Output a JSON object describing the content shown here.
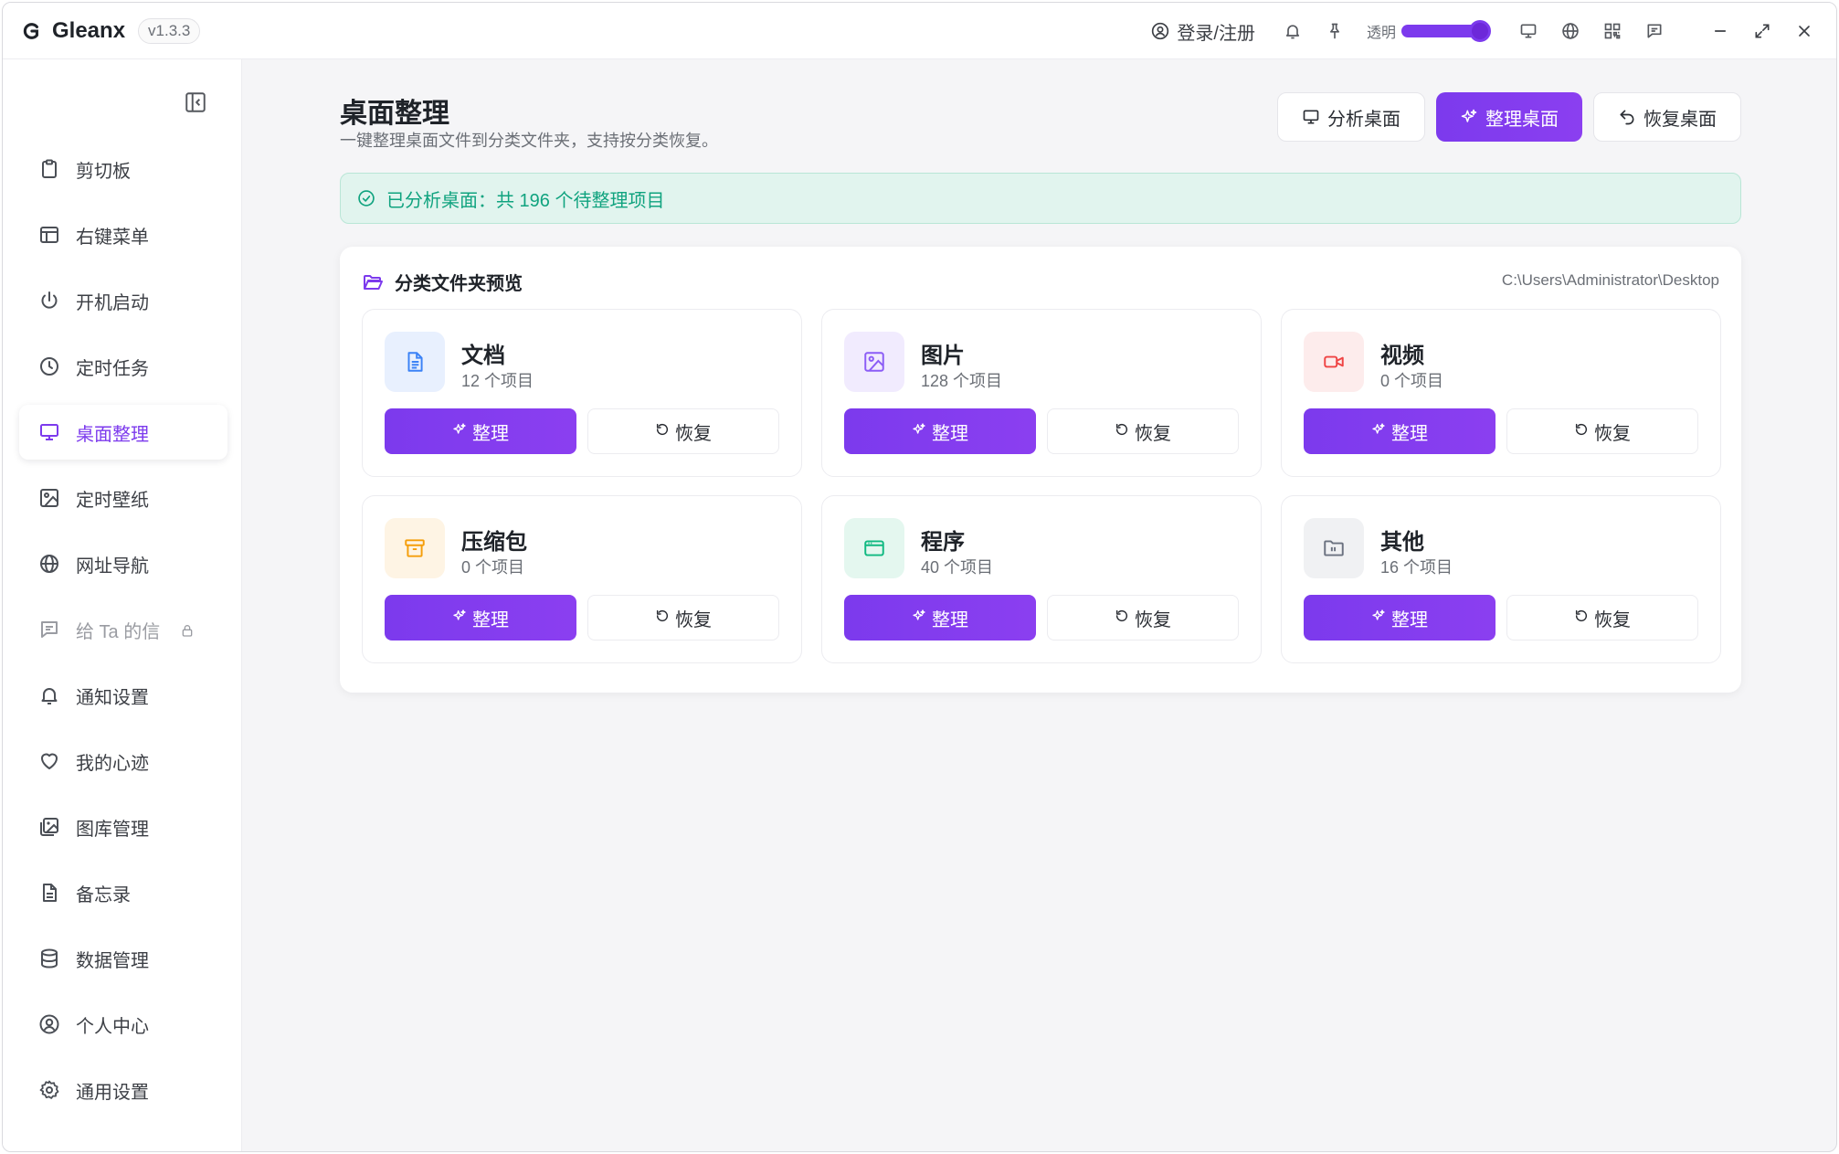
{
  "app": {
    "name": "Gleanx",
    "version": "v1.3.3"
  },
  "titlebar": {
    "login_label": "登录/注册",
    "opacity_label": "透明",
    "opacity_value": 0.9
  },
  "sidebar": {
    "items": [
      {
        "label": "剪切板",
        "icon": "clipboard-icon"
      },
      {
        "label": "右键菜单",
        "icon": "layout-icon"
      },
      {
        "label": "开机启动",
        "icon": "power-icon"
      },
      {
        "label": "定时任务",
        "icon": "clock-icon"
      },
      {
        "label": "桌面整理",
        "icon": "monitor-icon",
        "active": true
      },
      {
        "label": "定时壁纸",
        "icon": "image-icon"
      },
      {
        "label": "网址导航",
        "icon": "globe-icon"
      },
      {
        "label": "给 Ta 的信",
        "icon": "message-icon",
        "locked": true
      },
      {
        "label": "通知设置",
        "icon": "bell-icon"
      },
      {
        "label": "我的心迹",
        "icon": "heart-icon"
      },
      {
        "label": "图库管理",
        "icon": "images-icon"
      },
      {
        "label": "备忘录",
        "icon": "file-text-icon"
      },
      {
        "label": "数据管理",
        "icon": "database-icon"
      },
      {
        "label": "个人中心",
        "icon": "user-circle-icon"
      },
      {
        "label": "通用设置",
        "icon": "gear-icon"
      }
    ]
  },
  "page": {
    "title": "桌面整理",
    "subtitle": "一键整理桌面文件到分类文件夹，支持按分类恢复。",
    "actions": {
      "analyze": "分析桌面",
      "organize": "整理桌面",
      "restore": "恢复桌面"
    },
    "alert": "已分析桌面：共 196 个待整理项目"
  },
  "preview": {
    "title": "分类文件夹预览",
    "path": "C:\\Users\\Administrator\\Desktop",
    "organize_label": "整理",
    "restore_label": "恢复",
    "categories": [
      {
        "name": "文档",
        "count": "12 个项目",
        "color": "#3b82f6",
        "bg": "#e8f0fe",
        "icon": "document-icon"
      },
      {
        "name": "图片",
        "count": "128 个项目",
        "color": "#8b5cf6",
        "bg": "#f1ebfe",
        "icon": "image-icon"
      },
      {
        "name": "视频",
        "count": "0 个项目",
        "color": "#ef4444",
        "bg": "#fdecec",
        "icon": "video-icon"
      },
      {
        "name": "压缩包",
        "count": "0 个项目",
        "color": "#f59e0b",
        "bg": "#fef4e4",
        "icon": "archive-icon"
      },
      {
        "name": "程序",
        "count": "40 个项目",
        "color": "#10b981",
        "bg": "#e4f7ef",
        "icon": "app-window-icon"
      },
      {
        "name": "其他",
        "count": "16 个项目",
        "color": "#6b7280",
        "bg": "#f0f1f3",
        "icon": "folder-icon"
      }
    ]
  },
  "colors": {
    "accent": "#7c3aed",
    "success": "#10a37f"
  }
}
